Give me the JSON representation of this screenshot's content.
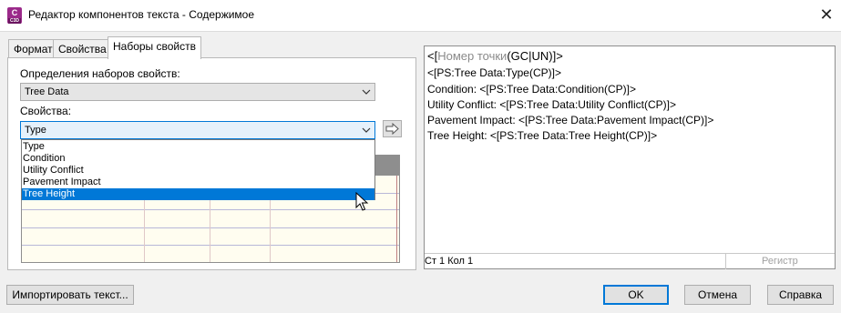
{
  "window": {
    "title": "Редактор компонентов текста - Содержимое",
    "icon_text": "C",
    "icon_sub": "C3D",
    "close_glyph": "✕"
  },
  "tabs": [
    {
      "label": "Формат"
    },
    {
      "label": "Свойства"
    },
    {
      "label": "Наборы свойств"
    }
  ],
  "property_sets": {
    "definitions_label": "Определения наборов свойств:",
    "definition_value": "Tree Data",
    "properties_label": "Свойства:",
    "property_value": "Type",
    "options": [
      "Type",
      "Condition",
      "Utility Conflict",
      "Pavement Impact",
      "Tree Height"
    ],
    "highlighted_option": "Tree Height"
  },
  "editor": {
    "line1_open": "<[",
    "line1_placeholder": "Номер точки",
    "line1_close": "(GC|UN)]>",
    "lines": [
      "<[PS:Tree Data:Type(CP)]>",
      "Condition: <[PS:Tree Data:Condition(CP)]>",
      "Utility Conflict: <[PS:Tree Data:Utility Conflict(CP)]>",
      "Pavement Impact: <[PS:Tree Data:Pavement Impact(CP)]>",
      "Tree Height: <[PS:Tree Data:Tree Height(CP)]>"
    ],
    "status_position": "Ст 1 Кол 1",
    "status_register": "Регистр"
  },
  "buttons": {
    "import": "Импортировать текст...",
    "ok": "OK",
    "cancel": "Отмена",
    "help": "Справка"
  },
  "colors": {
    "accent": "#0078d7",
    "app_icon": "#9b2a8a"
  }
}
